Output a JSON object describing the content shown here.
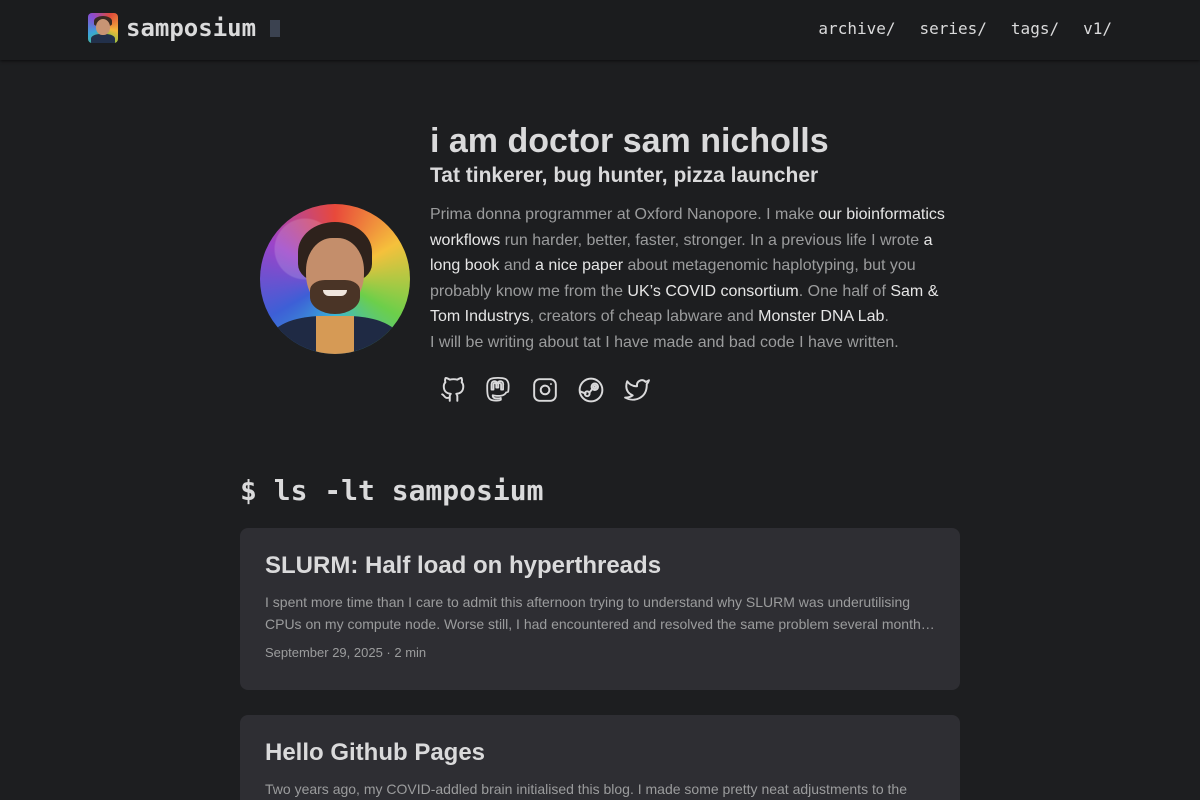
{
  "header": {
    "site_title": "samposium",
    "nav": [
      "archive/",
      "series/",
      "tags/",
      "v1/"
    ]
  },
  "profile": {
    "title": "i am doctor sam nicholls",
    "subtitle": "Tat tinkerer, bug hunter, pizza launcher",
    "bio": {
      "t1": "Prima donna programmer at Oxford Nanopore. I make ",
      "l1": "our bioinformatics workflows",
      "t2": " run harder, better, faster, stronger. In a previous life I wrote ",
      "l2": "a long book",
      "t3": " and ",
      "l3": "a nice paper",
      "t4": " about metagenomic haplotyping, but you probably know me from the ",
      "l4": "UK’s COVID consortium",
      "t5": ". One half of ",
      "l5": "Sam & Tom Industrys",
      "t6": ", creators of cheap labware and ",
      "l6": "Monster DNA Lab",
      "t7": "."
    },
    "bio_line2": "I will be writing about tat I have made and bad code I have written.",
    "socials": [
      "github-icon",
      "mastodon-icon",
      "instagram-icon",
      "steam-icon",
      "twitter-icon"
    ]
  },
  "posts_heading": "$ ls -lt samposium",
  "posts": [
    {
      "title": "SLURM: Half load on hyperthreads",
      "summary": "I spent more time than I care to admit this afternoon trying to understand why SLURM was underutilising CPUs on my compute node. Worse still, I had encountered and resolved the same problem several months ago.",
      "date": "September 29, 2025",
      "sep": " · ",
      "read_time": "2 min"
    },
    {
      "title": "Hello Github Pages",
      "summary": "Two years ago, my COVID-addled brain initialised this blog. I made some pretty neat adjustments to the theme.",
      "date": "",
      "sep": "",
      "read_time": ""
    }
  ],
  "colors": {
    "background": "#1d1e20",
    "header_bg": "#1b1c1e",
    "card_bg": "#2e2e33",
    "text_primary": "#dadadb",
    "text_secondary": "#9b9c9d"
  }
}
